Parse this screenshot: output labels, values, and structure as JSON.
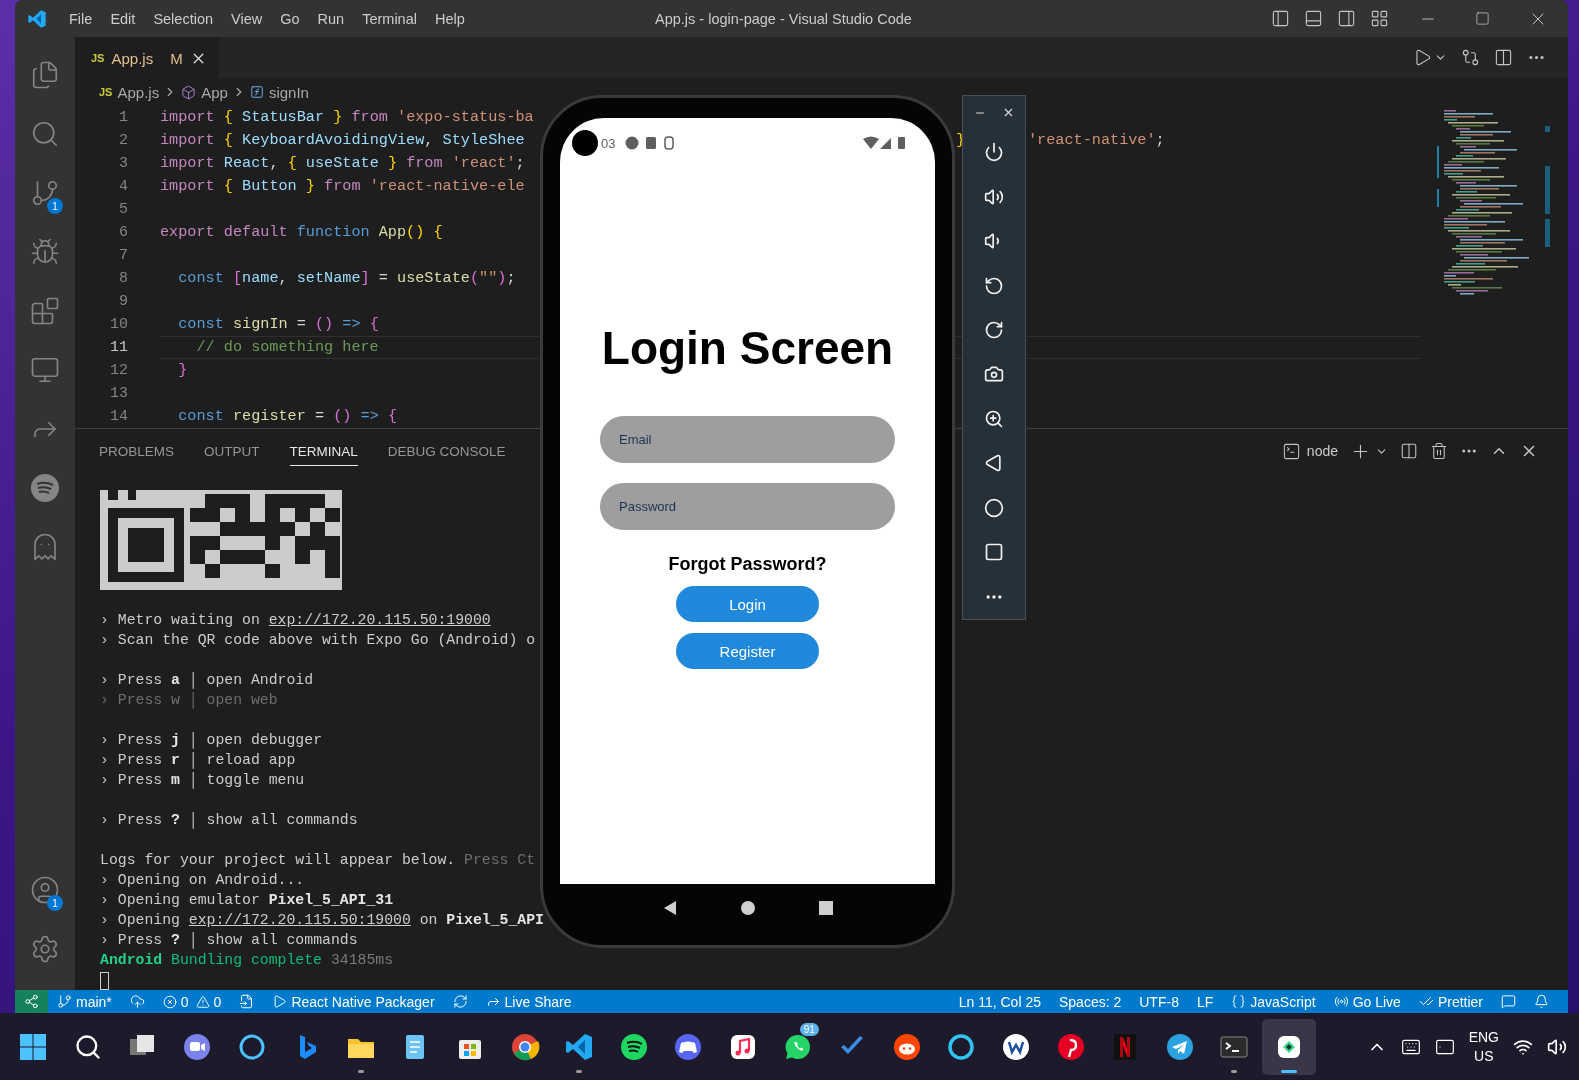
{
  "window": {
    "title": "App.js - login-page - Visual Studio Code"
  },
  "menu": [
    "File",
    "Edit",
    "Selection",
    "View",
    "Go",
    "Run",
    "Terminal",
    "Help"
  ],
  "activity_bar": {
    "top": [
      {
        "kind": "explorer"
      },
      {
        "kind": "search"
      },
      {
        "kind": "source-control",
        "badge": "1"
      },
      {
        "kind": "run"
      },
      {
        "kind": "extensions"
      },
      {
        "kind": "remote"
      },
      {
        "kind": "live-share"
      },
      {
        "kind": "music"
      },
      {
        "kind": "pet"
      }
    ],
    "bottom": [
      {
        "kind": "accounts",
        "badge": "1"
      },
      {
        "kind": "settings"
      }
    ]
  },
  "editor_tab": {
    "icon_text": "JS",
    "label": "App.js",
    "status": "M",
    "selected": true
  },
  "breadcrumbs": [
    {
      "kind": "file",
      "icon_text": "JS",
      "text": "App.js"
    },
    {
      "kind": "module",
      "text": "App"
    },
    {
      "kind": "method",
      "text": "signIn"
    }
  ],
  "code_lines": [
    {
      "number": "1",
      "current": false,
      "segments": [
        {
          "kind": "keyword",
          "text": "import "
        },
        {
          "kind": "brace",
          "text": "{"
        },
        {
          "kind": "variable",
          "text": " StatusBar "
        },
        {
          "kind": "brace",
          "text": "}"
        },
        {
          "kind": "keyword",
          "text": " from "
        },
        {
          "kind": "string",
          "text": "'expo-status-ba"
        }
      ]
    },
    {
      "number": "2",
      "current": false,
      "segments": [
        {
          "kind": "keyword",
          "text": "import "
        },
        {
          "kind": "brace",
          "text": "{"
        },
        {
          "kind": "variable",
          "text": " KeyboardAvoidingView"
        },
        {
          "kind": "plain",
          "text": ", "
        },
        {
          "kind": "variable",
          "text": "StyleShee"
        }
      ],
      "fragments": [
        {
          "segments": [
            {
              "kind": "brace",
              "text": "}"
            }
          ]
        },
        {
          "segments": [
            {
              "kind": "string",
              "text": "'react-native'"
            },
            {
              "kind": "plain",
              "text": ";"
            }
          ]
        }
      ]
    },
    {
      "number": "3",
      "current": false,
      "segments": [
        {
          "kind": "keyword",
          "text": "import "
        },
        {
          "kind": "variable",
          "text": "React"
        },
        {
          "kind": "plain",
          "text": ", "
        },
        {
          "kind": "brace",
          "text": "{"
        },
        {
          "kind": "variable",
          "text": " useState "
        },
        {
          "kind": "brace",
          "text": "}"
        },
        {
          "kind": "keyword",
          "text": " from "
        },
        {
          "kind": "string",
          "text": "'react'"
        },
        {
          "kind": "plain",
          "text": ";"
        }
      ]
    },
    {
      "number": "4",
      "current": false,
      "segments": [
        {
          "kind": "keyword",
          "text": "import "
        },
        {
          "kind": "brace",
          "text": "{"
        },
        {
          "kind": "variable",
          "text": " Button "
        },
        {
          "kind": "brace",
          "text": "}"
        },
        {
          "kind": "keyword",
          "text": " from "
        },
        {
          "kind": "string",
          "text": "'react-native-ele"
        }
      ]
    },
    {
      "number": "5",
      "current": false
    },
    {
      "number": "6",
      "current": false,
      "segments": [
        {
          "kind": "keyword",
          "text": "export default "
        },
        {
          "kind": "declaration",
          "text": "function "
        },
        {
          "kind": "function",
          "text": "App"
        },
        {
          "kind": "brace",
          "text": "() {"
        }
      ]
    },
    {
      "number": "7",
      "current": false
    },
    {
      "number": "8",
      "current": false,
      "segments": [
        {
          "kind": "declaration",
          "text": "  const "
        },
        {
          "kind": "bracket",
          "text": "["
        },
        {
          "kind": "variable",
          "text": "name"
        },
        {
          "kind": "plain",
          "text": ", "
        },
        {
          "kind": "variable",
          "text": "setName"
        },
        {
          "kind": "bracket",
          "text": "]"
        },
        {
          "kind": "plain",
          "text": " = "
        },
        {
          "kind": "function",
          "text": "useState"
        },
        {
          "kind": "bracket",
          "text": "("
        },
        {
          "kind": "string",
          "text": "\"\""
        },
        {
          "kind": "bracket",
          "text": ")"
        },
        {
          "kind": "plain",
          "text": ";"
        }
      ]
    },
    {
      "number": "9",
      "current": false
    },
    {
      "number": "10",
      "current": false,
      "segments": [
        {
          "kind": "declaration",
          "text": "  const "
        },
        {
          "kind": "function",
          "text": "signIn"
        },
        {
          "kind": "plain",
          "text": " = "
        },
        {
          "kind": "bracket",
          "text": "()"
        },
        {
          "kind": "declaration",
          "text": " => "
        },
        {
          "kind": "bracket",
          "text": "{"
        }
      ]
    },
    {
      "number": "11",
      "current": true,
      "segments": [
        {
          "kind": "comment",
          "text": "    // do something here"
        }
      ]
    },
    {
      "number": "12",
      "current": false,
      "segments": [
        {
          "kind": "bracket",
          "text": "  }"
        }
      ]
    },
    {
      "number": "13",
      "current": false
    },
    {
      "number": "14",
      "current": false,
      "segments": [
        {
          "kind": "declaration",
          "text": "  const "
        },
        {
          "kind": "function",
          "text": "register"
        },
        {
          "kind": "plain",
          "text": " = "
        },
        {
          "kind": "bracket",
          "text": "()"
        },
        {
          "kind": "declaration",
          "text": " => "
        },
        {
          "kind": "bracket",
          "text": "{"
        }
      ]
    }
  ],
  "panel": {
    "tabs": [
      {
        "label": "PROBLEMS",
        "selected": false
      },
      {
        "label": "OUTPUT",
        "selected": false
      },
      {
        "label": "TERMINAL",
        "selected": true
      },
      {
        "label": "DEBUG CONSOLE",
        "selected": false
      }
    ],
    "terminal_name": "node",
    "blocks": [
      {
        "lines": [
          {
            "segments": [
              {
                "kind": "plain",
                "text": "› Metro waiting on "
              },
              {
                "kind": "link",
                "text": "exp://172.20.115.50:19000"
              }
            ]
          },
          {
            "segments": [
              {
                "kind": "plain",
                "text": "› Scan the QR code above with Expo Go (Android) o"
              }
            ]
          }
        ]
      },
      {
        "lines": [
          {
            "segments": [
              {
                "kind": "plain",
                "text": "› Press "
              },
              {
                "kind": "bold",
                "text": "a"
              },
              {
                "kind": "plain",
                "text": " │ open Android"
              }
            ]
          },
          {
            "segments": [
              {
                "kind": "dim",
                "text": "› Press w │ open web"
              }
            ]
          }
        ]
      },
      {
        "lines": [
          {
            "segments": [
              {
                "kind": "plain",
                "text": "› Press "
              },
              {
                "kind": "bold",
                "text": "j"
              },
              {
                "kind": "plain",
                "text": " │ open debugger"
              }
            ]
          },
          {
            "segments": [
              {
                "kind": "plain",
                "text": "› Press "
              },
              {
                "kind": "bold",
                "text": "r"
              },
              {
                "kind": "plain",
                "text": " │ reload app"
              }
            ]
          },
          {
            "segments": [
              {
                "kind": "plain",
                "text": "› Press "
              },
              {
                "kind": "bold",
                "text": "m"
              },
              {
                "kind": "plain",
                "text": " │ toggle menu"
              }
            ]
          }
        ]
      },
      {
        "lines": [
          {
            "segments": [
              {
                "kind": "plain",
                "text": "› Press "
              },
              {
                "kind": "bold",
                "text": "?"
              },
              {
                "kind": "plain",
                "text": " │ show all commands"
              }
            ]
          }
        ]
      },
      {
        "lines": [
          {
            "segments": [
              {
                "kind": "plain",
                "text": "Logs for your project will appear below."
              },
              {
                "kind": "dim",
                "text": " Press Ct"
              }
            ]
          },
          {
            "segments": [
              {
                "kind": "plain",
                "text": "› Opening on Android..."
              }
            ]
          },
          {
            "segments": [
              {
                "kind": "plain",
                "text": "› Opening emulator "
              },
              {
                "kind": "bold",
                "text": "Pixel_5_API_31"
              }
            ]
          },
          {
            "segments": [
              {
                "kind": "plain",
                "text": "› Opening "
              },
              {
                "kind": "link",
                "text": "exp://172.20.115.50:19000"
              },
              {
                "kind": "plain",
                "text": " on "
              },
              {
                "kind": "bold",
                "text": "Pixel_5_API"
              }
            ]
          },
          {
            "segments": [
              {
                "kind": "plain",
                "text": "› Press "
              },
              {
                "kind": "bold",
                "text": "?"
              },
              {
                "kind": "plain",
                "text": " │ show all commands"
              }
            ]
          },
          {
            "segments": [
              {
                "kind": "success-bold",
                "text": "Android"
              },
              {
                "kind": "success",
                "text": " Bundling complete"
              },
              {
                "kind": "muted",
                "text": " 34185ms"
              }
            ]
          }
        ]
      }
    ]
  },
  "phone": {
    "clock": "03",
    "title": "Login Screen",
    "fields": [
      {
        "placeholder": "Email"
      },
      {
        "placeholder": "Password"
      }
    ],
    "forgot": "Forgot Password?",
    "buttons": [
      "Login",
      "Register"
    ]
  },
  "status_bar": {
    "left": [
      {
        "kind": "remote"
      },
      {
        "kind": "branch",
        "text": "main*"
      },
      {
        "kind": "publish"
      },
      {
        "kind": "problems",
        "errors": "0",
        "warnings": "0"
      },
      {
        "kind": "port"
      },
      {
        "kind": "run",
        "text": "React Native Packager"
      },
      {
        "kind": "sync"
      },
      {
        "kind": "live-share",
        "text": "Live Share"
      }
    ],
    "right": [
      {
        "kind": "text",
        "text": "Ln 11, Col 25"
      },
      {
        "kind": "text",
        "text": "Spaces: 2"
      },
      {
        "kind": "text",
        "text": "UTF-8"
      },
      {
        "kind": "text",
        "text": "LF"
      },
      {
        "kind": "language",
        "text": "JavaScript"
      },
      {
        "kind": "go-live",
        "text": "Go Live"
      },
      {
        "kind": "prettier",
        "text": "Prettier"
      },
      {
        "kind": "feedback"
      },
      {
        "kind": "bell"
      }
    ]
  },
  "taskbar": {
    "apps": [
      {
        "kind": "start",
        "running": false,
        "focused": false
      },
      {
        "kind": "search",
        "running": false,
        "focused": false
      },
      {
        "kind": "task-view",
        "running": false,
        "focused": false
      },
      {
        "kind": "video-chat",
        "running": false,
        "focused": false
      },
      {
        "kind": "ring",
        "running": false,
        "focused": false
      },
      {
        "kind": "bing",
        "running": false,
        "focused": false
      },
      {
        "kind": "folder",
        "running": true,
        "focused": false
      },
      {
        "kind": "notepad",
        "running": false,
        "focused": false
      },
      {
        "kind": "store",
        "running": false,
        "focused": false
      },
      {
        "kind": "browser",
        "running": false,
        "focused": false
      },
      {
        "kind": "editor",
        "running": true,
        "focused": false
      },
      {
        "kind": "music-circle",
        "running": false,
        "focused": false
      },
      {
        "kind": "gamepad",
        "running": false,
        "focused": false
      },
      {
        "kind": "music-note",
        "running": false,
        "focused": false
      },
      {
        "kind": "phone-chat",
        "running": false,
        "focused": false,
        "badge": "91"
      },
      {
        "kind": "check",
        "running": false,
        "focused": false
      },
      {
        "kind": "alien",
        "running": false,
        "focused": false
      },
      {
        "kind": "ring-blue",
        "running": false,
        "focused": false
      },
      {
        "kind": "w-app",
        "running": false,
        "focused": false
      },
      {
        "kind": "pin",
        "running": false,
        "focused": false
      },
      {
        "kind": "red-tile",
        "running": false,
        "focused": false
      },
      {
        "kind": "paper-plane",
        "running": false,
        "focused": false
      },
      {
        "kind": "terminal",
        "running": true,
        "focused": false
      },
      {
        "kind": "emulator",
        "running": true,
        "focused": true
      }
    ],
    "language": "ENG",
    "region": "US"
  }
}
